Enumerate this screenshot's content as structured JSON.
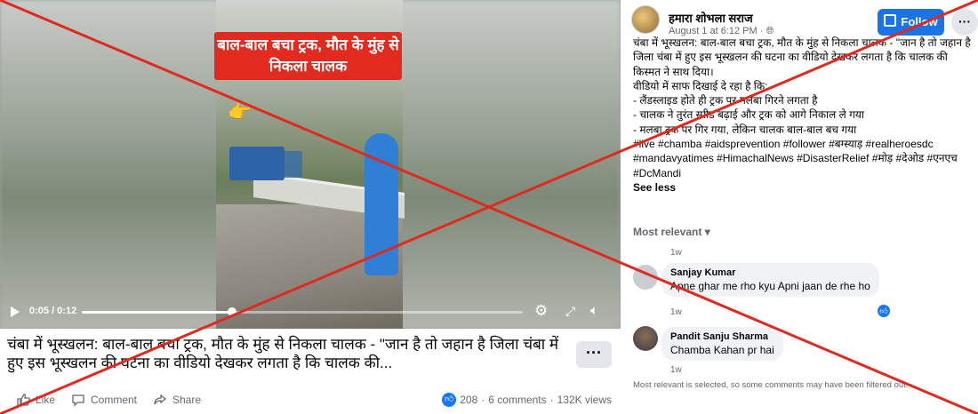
{
  "video": {
    "headline": "बाल-बाल बचा ट्रक, मौत के मुंह से निकला चालक",
    "emoji": "👉",
    "time": "0:05 / 0:12",
    "progress": 0.34
  },
  "caption": {
    "text": "चंबा में भूस्खलन: बाल-बाल बचा ट्रक, मौत के मुंह से निकला चालक - \"जान है तो जहान है जिला चंबा में हुए इस भूस्खलन की घटना का वीडियो देखकर लगता है कि चालक की...",
    "more_label": "···"
  },
  "actions": {
    "like": "Like",
    "comment": "Comment",
    "share": "Share",
    "reactions": "208",
    "comments": "6 comments",
    "views": "132K views"
  },
  "post": {
    "page_name": "हमारा शोभला सराज",
    "date": "August 1 at 6:12 PM · ",
    "follow": "Follow",
    "more": "···",
    "lines": [
      "चंबा में भूस्खलन: बाल-बाल बचा ट्रक, मौत के मुंह से निकला चालक - \"जान है तो जहान है",
      "जिला चंबा में हुए इस भूस्खलन की घटना का वीडियो देखकर लगता है कि चालक की किस्मत ने साथ दिया।",
      "वीडियो में साफ दिखाई दे रहा है कि:",
      "- लैंडस्लाइड होते ही ट्रक पर मलबा गिरने लगता है",
      "- चालक ने तुरंत स्पीड बढ़ाई और ट्रक को आगे निकाल ले गया",
      "- मलबा ट्रक पर गिर गया, लेकिन चालक बाल-बाल बच गया"
    ],
    "hashtags": "#live #chamba #aidsprevention #follower #बग्स्याड़ #realheroesdc #mandavyatimes #HimachalNews #DisasterRelief #मोड़ #देओड #एनएच #DcMandi",
    "see_less": "See less"
  },
  "comments": {
    "sort_label": "Most relevant ▾",
    "first_time": "1w",
    "items": [
      {
        "name": "Sanjay Kumar",
        "text": "Apne ghar me rho kyu Apni jaan de rhe ho",
        "time": "1w"
      },
      {
        "name": "Pandit Sanju Sharma",
        "text": "Chamba Kahan pr hai",
        "time": "1w"
      }
    ],
    "filter_note": "Most relevant is selected, so some comments may have been filtered out."
  },
  "colors": {
    "accent": "#1b74e4",
    "cross": "#e0291f",
    "headline_bg": "#e32a1f"
  }
}
